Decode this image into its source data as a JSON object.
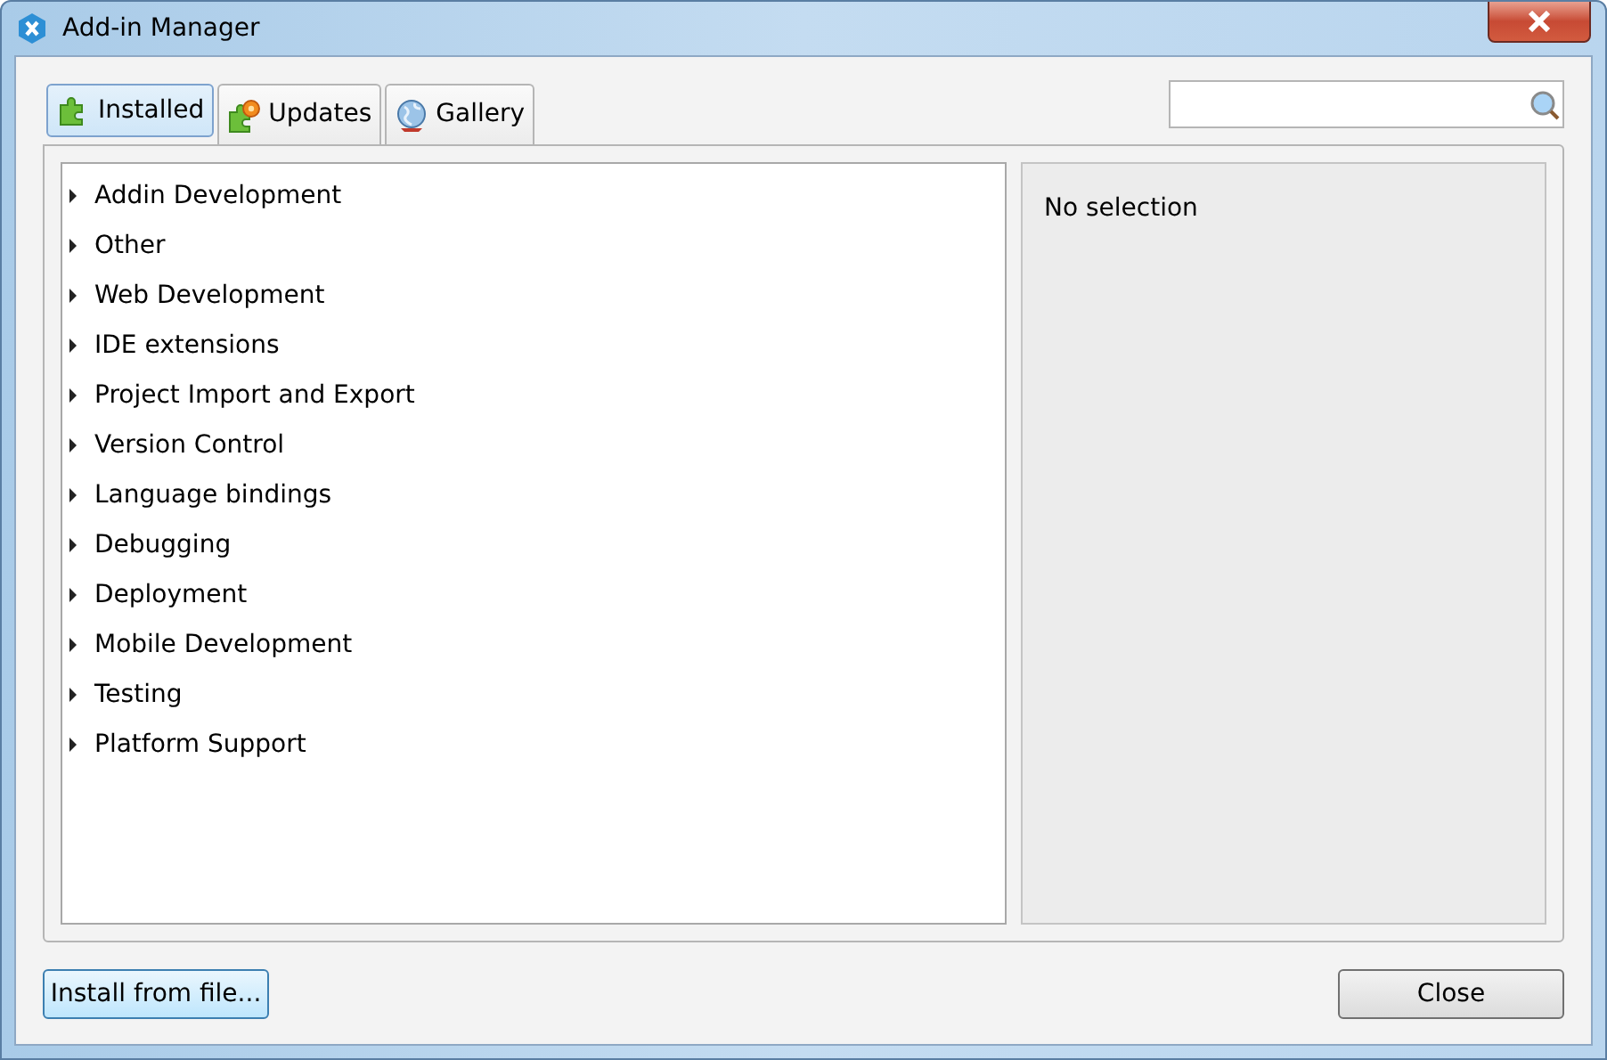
{
  "window": {
    "title": "Add-in Manager"
  },
  "tabs": [
    {
      "label": "Installed",
      "selected": true,
      "kind": "installed"
    },
    {
      "label": "Updates",
      "selected": false,
      "kind": "updates"
    },
    {
      "label": "Gallery",
      "selected": false,
      "kind": "gallery"
    }
  ],
  "search": {
    "kind": "search"
  },
  "tree": {
    "items": [
      {
        "label": "Addin Development",
        "expanded": false
      },
      {
        "label": "Other",
        "expanded": false
      },
      {
        "label": "Web Development",
        "expanded": false
      },
      {
        "label": "IDE extensions",
        "expanded": false
      },
      {
        "label": "Project Import and Export",
        "expanded": false
      },
      {
        "label": "Version Control",
        "expanded": false
      },
      {
        "label": "Language bindings",
        "expanded": false
      },
      {
        "label": "Debugging",
        "expanded": false
      },
      {
        "label": "Deployment",
        "expanded": false
      },
      {
        "label": "Mobile Development",
        "expanded": false
      },
      {
        "label": "Testing",
        "expanded": false
      },
      {
        "label": "Platform Support",
        "expanded": false
      }
    ]
  },
  "details": {
    "text": "No selection"
  },
  "buttons": [
    {
      "label": "Install from file...",
      "focused": true
    },
    {
      "label": "Close",
      "focused": false
    }
  ]
}
